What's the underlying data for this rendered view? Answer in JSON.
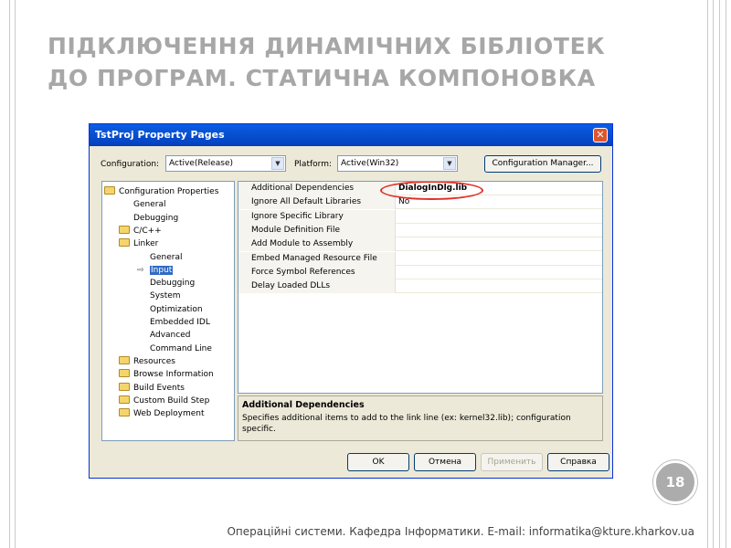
{
  "slide": {
    "title_line1": "ПІДКЛЮЧЕННЯ ДИНАМІЧНИХ БІБЛІОТЕК",
    "title_line2": "ДО ПРОГРАМ. СТАТИЧНА КОМПОНОВКА",
    "page_number": "18",
    "footer": "Операційні системи. Кафедра Інформатики. E-mail: informatika@kture.kharkov.ua"
  },
  "dialog": {
    "title": "TstProj Property Pages",
    "close_glyph": "✕",
    "configuration_label": "Configuration:",
    "configuration_value": "Active(Release)",
    "platform_label": "Platform:",
    "platform_value": "Active(Win32)",
    "config_manager_label": "Configuration Manager...",
    "tree": [
      {
        "label": "Configuration Properties",
        "folder": true
      },
      {
        "label": "General",
        "folder": false
      },
      {
        "label": "Debugging",
        "folder": false
      },
      {
        "label": "C/C++",
        "folder": true
      },
      {
        "label": "Linker",
        "folder": true
      },
      {
        "label": "General",
        "folder": false
      },
      {
        "label": "Input",
        "folder": false,
        "selected": true
      },
      {
        "label": "Debugging",
        "folder": false
      },
      {
        "label": "System",
        "folder": false
      },
      {
        "label": "Optimization",
        "folder": false
      },
      {
        "label": "Embedded IDL",
        "folder": false
      },
      {
        "label": "Advanced",
        "folder": false
      },
      {
        "label": "Command Line",
        "folder": false
      },
      {
        "label": "Resources",
        "folder": true
      },
      {
        "label": "Browse Information",
        "folder": true
      },
      {
        "label": "Build Events",
        "folder": true
      },
      {
        "label": "Custom Build Step",
        "folder": true
      },
      {
        "label": "Web Deployment",
        "folder": true
      }
    ],
    "properties": [
      {
        "name": "Additional Dependencies",
        "value": "DialogInDlg.lib"
      },
      {
        "name": "Ignore All Default Libraries",
        "value": "No"
      },
      {
        "name": "Ignore Specific Library",
        "value": ""
      },
      {
        "name": "Module Definition File",
        "value": ""
      },
      {
        "name": "Add Module to Assembly",
        "value": ""
      },
      {
        "name": "Embed Managed Resource File",
        "value": ""
      },
      {
        "name": "Force Symbol References",
        "value": ""
      },
      {
        "name": "Delay Loaded DLLs",
        "value": ""
      }
    ],
    "description_title": "Additional Dependencies",
    "description_text": "Specifies additional items to add to the link line (ex: kernel32.lib); configuration specific.",
    "buttons": {
      "ok": "OK",
      "cancel": "Отмена",
      "apply": "Применить",
      "help": "Справка"
    }
  },
  "colors": {
    "title_gray": "#a7a7a7",
    "titlebar_blue": "#0850cf",
    "selection_blue": "#316ac5",
    "highlight_red": "#e0302a"
  }
}
